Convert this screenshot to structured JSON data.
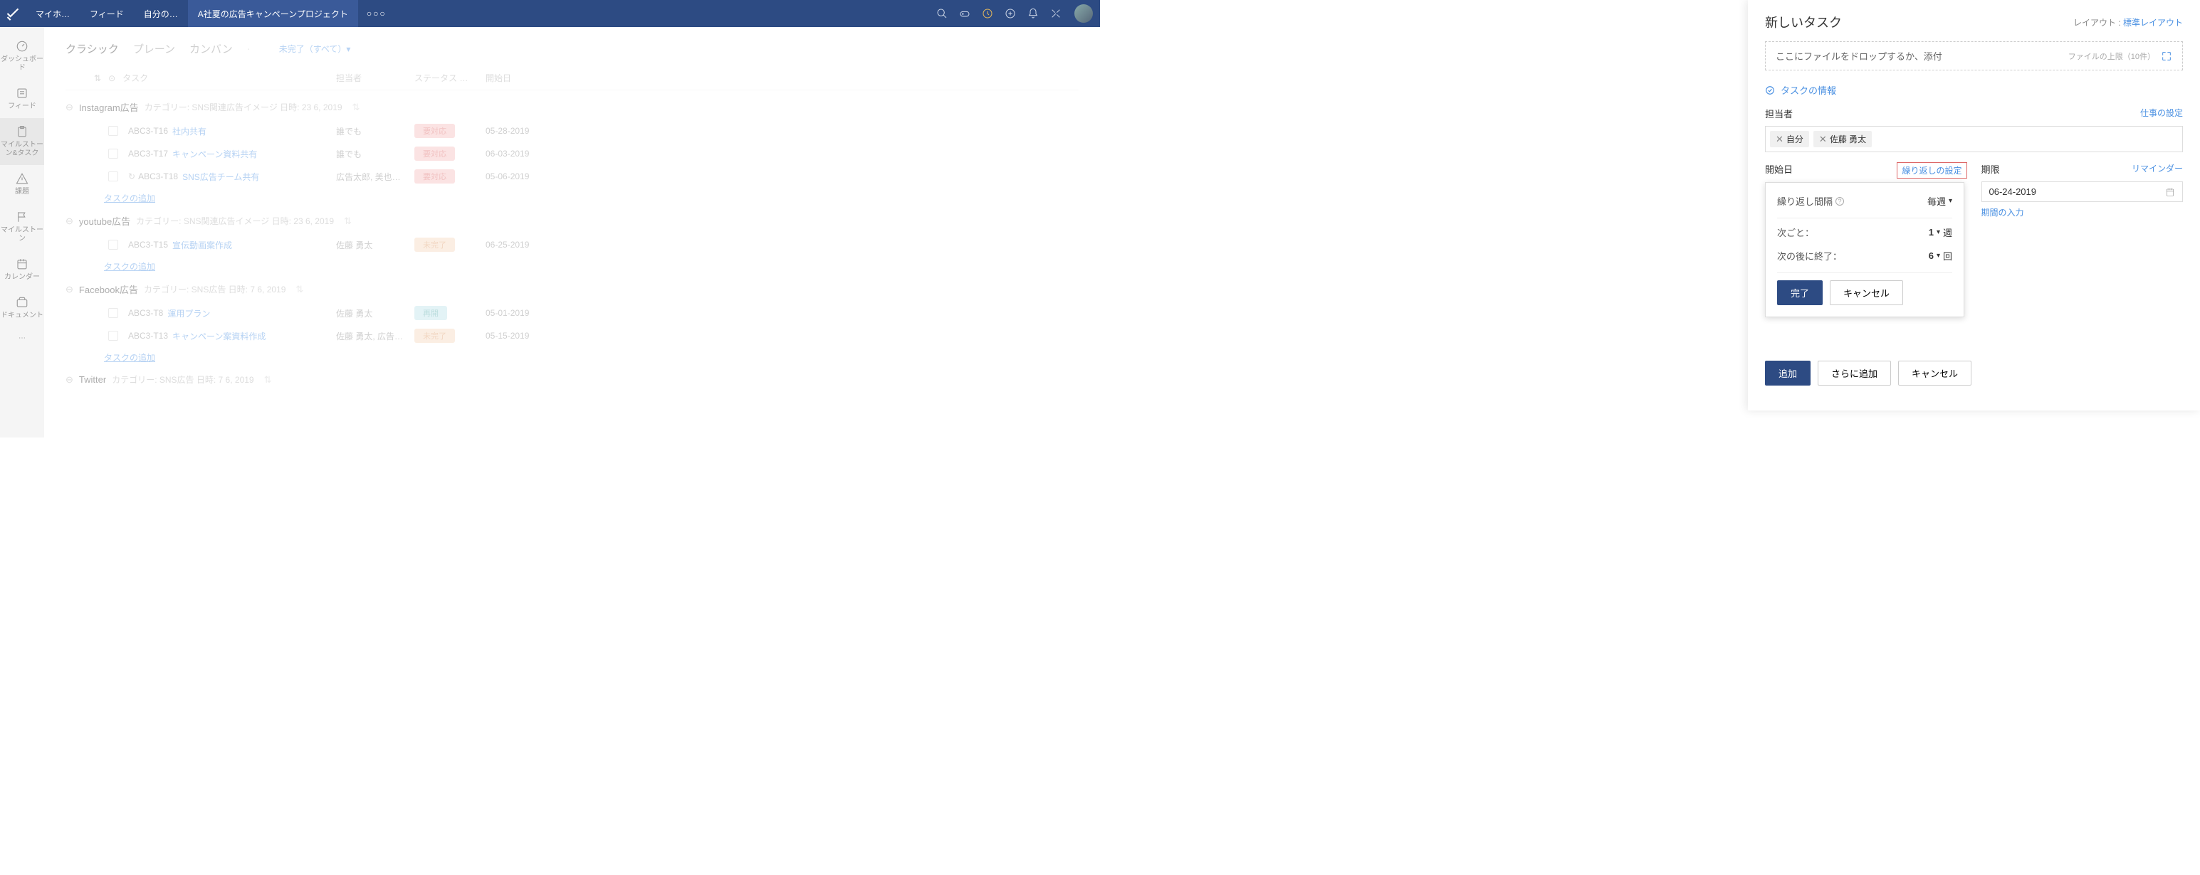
{
  "topbar": {
    "tabs": [
      "マイホ…",
      "フィード",
      "自分の…",
      "A社夏の広告キャンペーンプロジェクト"
    ]
  },
  "sidebar": {
    "items": [
      "ダッシュボード",
      "フィード",
      "マイルストーン&タスク",
      "課題",
      "マイルストーン",
      "カレンダー",
      "ドキュメント"
    ]
  },
  "views": {
    "classic": "クラシック",
    "plain": "プレーン",
    "kanban": "カンバン",
    "filter": "未完了（すべて）▾"
  },
  "cols": {
    "task": "タスク",
    "owner": "担当者",
    "status": "ステータス …",
    "start": "開始日"
  },
  "groups": [
    {
      "title": "Instagram広告",
      "meta": "カテゴリー: SNS関連広告イメージ 日時: 23 6, 2019",
      "tasks": [
        {
          "id": "ABC3-T16",
          "name": "社内共有",
          "owner": "誰でも",
          "status": "要対応",
          "badge": "red",
          "date": "05-28-2019"
        },
        {
          "id": "ABC3-T17",
          "name": "キャンペーン資料共有",
          "owner": "誰でも",
          "status": "要対応",
          "badge": "red",
          "date": "06-03-2019"
        },
        {
          "id": "ABC3-T18",
          "name": "SNS広告チーム共有",
          "owner": "広告太郎, 美也…",
          "status": "要対応",
          "badge": "red",
          "date": "05-06-2019",
          "recur": true
        }
      ]
    },
    {
      "title": "youtube広告",
      "meta": "カテゴリー: SNS関連広告イメージ 日時: 23 6, 2019",
      "tasks": [
        {
          "id": "ABC3-T15",
          "name": "宣伝動画案作成",
          "owner": "佐藤 勇太",
          "status": "未完了",
          "badge": "orange",
          "date": "06-25-2019"
        }
      ]
    },
    {
      "title": "Facebook広告",
      "meta": "カテゴリー: SNS広告 日時: 7 6, 2019",
      "tasks": [
        {
          "id": "ABC3-T8",
          "name": "運用プラン",
          "owner": "佐藤 勇太",
          "status": "再開",
          "badge": "blue",
          "date": "05-01-2019"
        },
        {
          "id": "ABC3-T13",
          "name": "キャンペーン案資料作成",
          "owner": "佐藤 勇太, 広告…",
          "status": "未完了",
          "badge": "orange",
          "date": "05-15-2019"
        }
      ]
    },
    {
      "title": "Twitter",
      "meta": "カテゴリー: SNS広告 日時: 7 6, 2019",
      "tasks": []
    }
  ],
  "addTask": "タスクの追加",
  "panel": {
    "title": "新しいタスク",
    "layoutLabel": "レイアウト :",
    "layoutLink": "標準レイアウト",
    "dropText": "ここにファイルをドロップするか、添付",
    "dropLimit": "ファイルの上限（10件）",
    "section": "タスクの情報",
    "ownerLabel": "担当者",
    "workSettings": "仕事の設定",
    "chips": [
      "自分",
      "佐藤 勇太"
    ],
    "startLabel": "開始日",
    "recurLink": "繰り返しの設定",
    "dueLabel": "期限",
    "reminderLink": "リマインダー",
    "dueDate": "06-24-2019",
    "periodLink": "期間の入力",
    "popup": {
      "intervalLabel": "繰り返し間隔",
      "intervalValue": "毎週",
      "everyLabel": "次ごと：",
      "everyValue": "1",
      "everyUnit": "週",
      "endLabel": "次の後に終了：",
      "endValue": "6",
      "endUnit": "回",
      "done": "完了",
      "cancel": "キャンセル"
    },
    "add": "追加",
    "addMore": "さらに追加",
    "cancel": "キャンセル"
  }
}
